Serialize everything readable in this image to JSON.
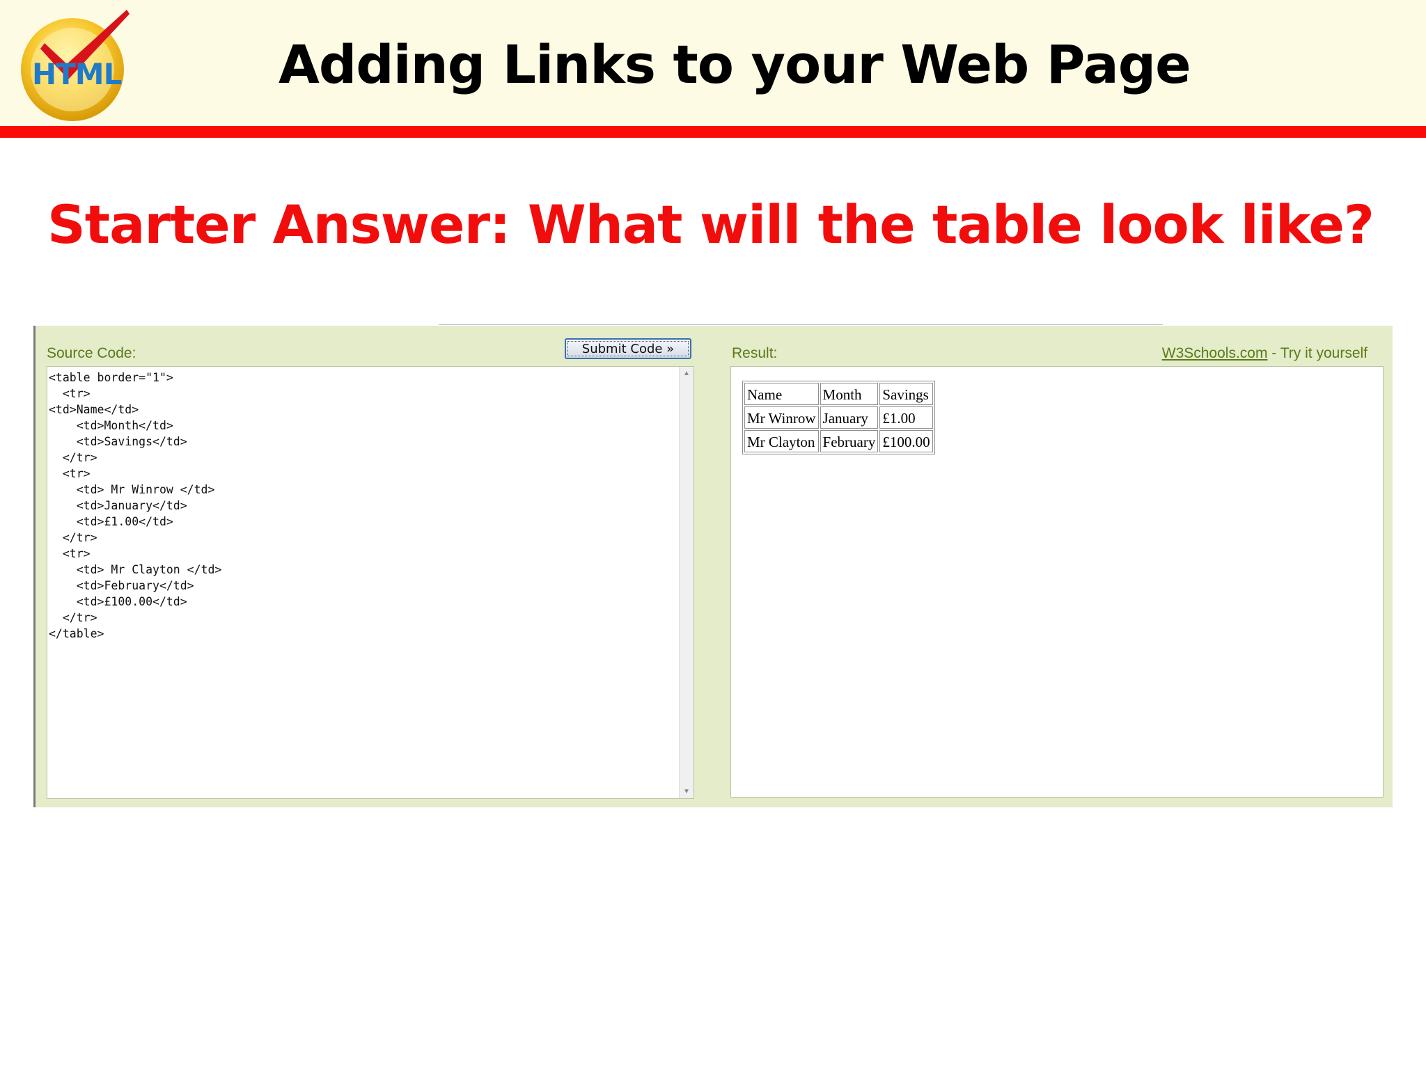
{
  "header": {
    "logo_text": "HTML",
    "title": "Adding Links to your Web Page"
  },
  "slide": {
    "heading": "Starter Answer: What will the table look like?"
  },
  "tryit": {
    "source_label": "Source Code:",
    "submit_label": "Submit Code »",
    "result_label": "Result:",
    "w3_link": "W3Schools.com",
    "w3_suffix": " - Try it yourself",
    "source_code": "<table border=\"1\">\n  <tr>\n<td>Name</td>\n    <td>Month</td>\n    <td>Savings</td>\n  </tr>\n  <tr>\n    <td> Mr Winrow </td>\n    <td>January</td>\n    <td>£1.00</td>\n  </tr>\n  <tr>\n    <td> Mr Clayton </td>\n    <td>February</td>\n    <td>£100.00</td>\n  </tr>\n</table>",
    "result_table": {
      "rows": [
        [
          "Name",
          "Month",
          "Savings"
        ],
        [
          "Mr Winrow",
          "January",
          "£1.00"
        ],
        [
          "Mr Clayton",
          "February",
          "£100.00"
        ]
      ]
    }
  },
  "colors": {
    "accent_red": "#fb0a0a",
    "header_bg": "#fdfbe3",
    "panel_bg": "#e4ecc9",
    "label_green": "#5b7a1a"
  },
  "icons": {
    "logo": "html-checkmark-logo-icon",
    "scroll_up": "scroll-up-arrow-icon",
    "scroll_down": "scroll-down-arrow-icon"
  }
}
